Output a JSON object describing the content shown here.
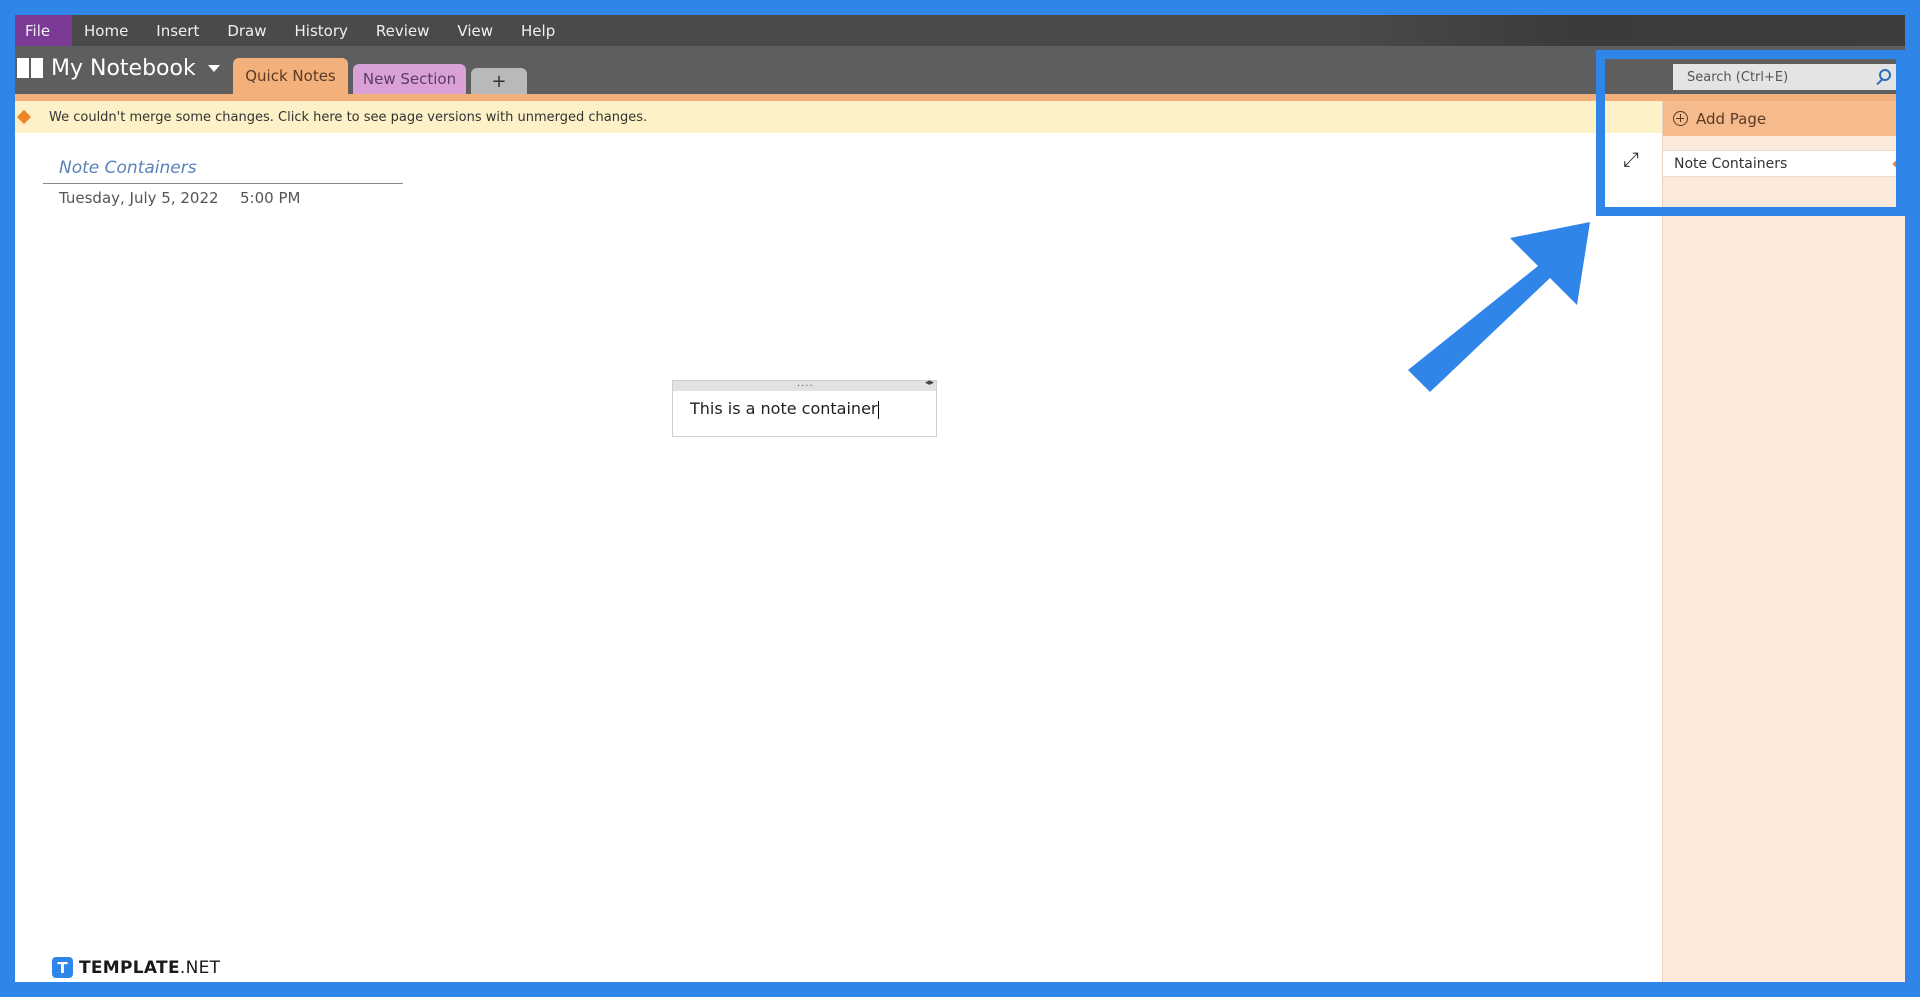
{
  "menu": {
    "file": "File",
    "items": [
      "Home",
      "Insert",
      "Draw",
      "History",
      "Review",
      "View",
      "Help"
    ]
  },
  "notebook": {
    "title": "My Notebook",
    "tabs": [
      {
        "label": "Quick Notes",
        "color": "#f4b07a"
      },
      {
        "label": "New Section",
        "color": "#d9a1d6"
      },
      {
        "label": "+",
        "color": "#b9b9b9"
      }
    ]
  },
  "search": {
    "placeholder": "Search (Ctrl+E)"
  },
  "infobar": {
    "message": "We couldn't merge some changes. Click here to see page versions with unmerged changes."
  },
  "page": {
    "title": "Note Containers",
    "date": "Tuesday, July 5, 2022",
    "time": "5:00 PM"
  },
  "note": {
    "text": "This is a note container"
  },
  "pages_panel": {
    "add_page": "Add Page",
    "pages": [
      "Note Containers"
    ]
  },
  "watermark": {
    "brand": "TEMPLATE",
    "suffix": ".NET"
  },
  "colors": {
    "highlight": "#2f86e8",
    "section_accent": "#f4b07a",
    "file_tab": "#7b3a96"
  }
}
